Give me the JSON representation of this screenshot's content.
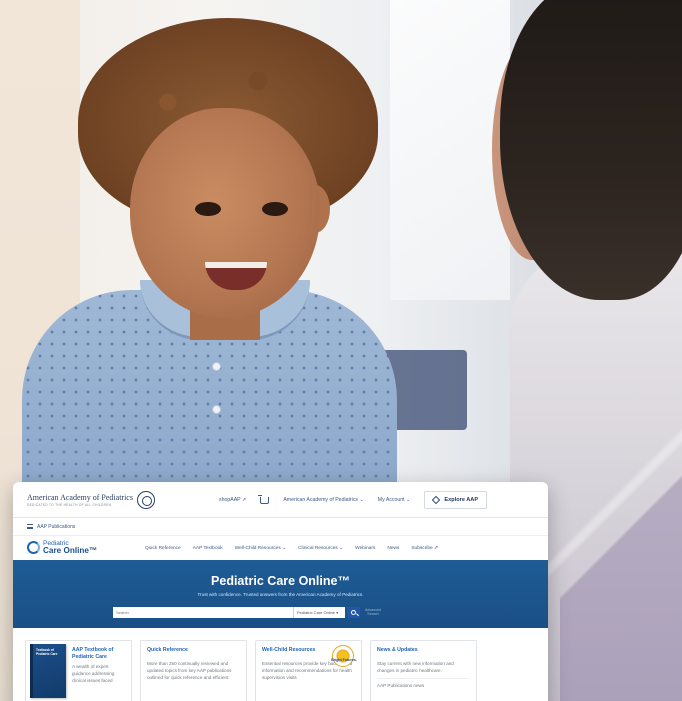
{
  "colors": {
    "brand_navy": "#23365a",
    "link_blue": "#1f63b4",
    "hero_blue": "#1e5c95",
    "search_button": "#2257a8"
  },
  "site": {
    "org_name": "American Academy of Pediatrics",
    "org_tagline": "DEDICATED TO THE HEALTH OF ALL CHILDREN",
    "top_nav": {
      "shop": "shopAAP ⇗",
      "aap_menu": "American Academy of Pediatrics ⌄",
      "account": "My Account ⌄",
      "explore": "Explore AAP"
    },
    "publications_label": "AAP Publications",
    "product_logo": {
      "line1": "Pediatric",
      "line2": "Care Online™"
    },
    "main_nav": [
      "Quick Reference",
      "AAP Textbook",
      "Well-Child Resources ⌄",
      "Clinical Resources ⌄",
      "Webinars",
      "News",
      "Subscribe ⇗"
    ]
  },
  "hero": {
    "title": "Pediatric Care Online™",
    "subtitle": "Trust with confidence. Trusted answers from the American Academy of Pediatrics.",
    "search": {
      "placeholder": "Search",
      "scope": "Pediatric Care Online ▾",
      "advanced": "Advanced Search"
    }
  },
  "cards": [
    {
      "title": "AAP Textbook of Pediatric Care",
      "body": "A wealth of expert guidance addressing clinical issues faced",
      "cover_text": "Textbook of Pediatric Care"
    },
    {
      "title": "Quick Reference",
      "body": "More than 250 continually reviewed and updated topics from key AAP publications outlined for quick reference and efficient"
    },
    {
      "title": "Well-Child Resources",
      "body": "Essential resources provide key background information and recommendations for health supervision visits",
      "badge": "Bright Futures."
    },
    {
      "title": "News & Updates",
      "body": "Stay current with new information and changes in pediatric healthcare.",
      "footer": "AAP Publications news"
    }
  ]
}
